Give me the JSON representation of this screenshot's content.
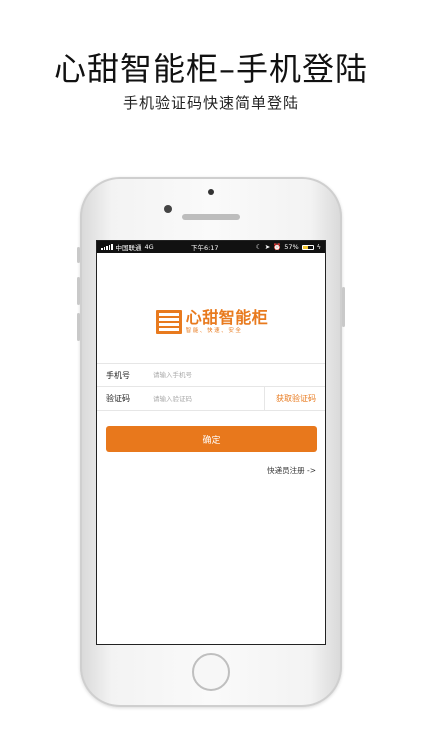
{
  "promo": {
    "title": "心甜智能柜–手机登陆",
    "subtitle": "手机验证码快速简单登陆"
  },
  "statusbar": {
    "carrier": "中国联通",
    "network": "4G",
    "time": "下午6:17",
    "battery_percent_text": "57%",
    "battery_level": 0.57
  },
  "app": {
    "logo_name": "心甜智能柜",
    "logo_slogan": "智能、快速、安全"
  },
  "form": {
    "phone_label": "手机号",
    "phone_placeholder": "请输入手机号",
    "code_label": "验证码",
    "code_placeholder": "请输入验证码",
    "get_code_label": "获取验证码",
    "confirm_label": "确定",
    "register_link": "快递员注册 ->"
  },
  "colors": {
    "accent": "#e8781c"
  }
}
